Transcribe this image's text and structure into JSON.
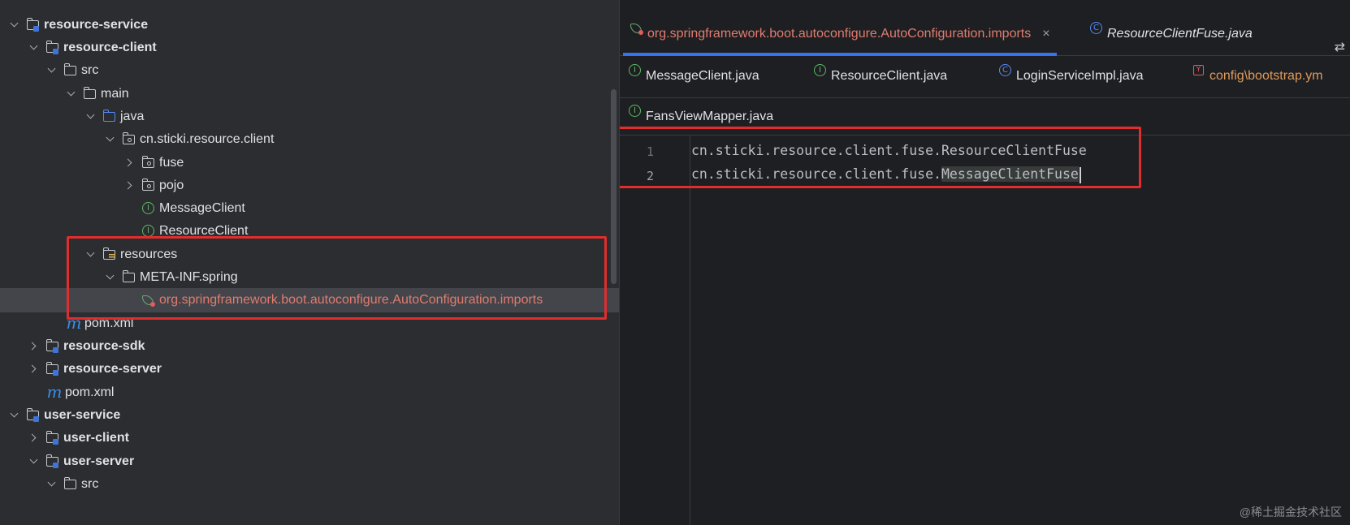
{
  "project_tree": {
    "rows": [
      {
        "label": "resource-service",
        "bold": true
      },
      {
        "label": "resource-client",
        "bold": true
      },
      {
        "label": "src"
      },
      {
        "label": "main"
      },
      {
        "label": "java"
      },
      {
        "label": "cn.sticki.resource.client"
      },
      {
        "label": "fuse"
      },
      {
        "label": "pojo"
      },
      {
        "label": "MessageClient"
      },
      {
        "label": "ResourceClient"
      },
      {
        "label": "resources"
      },
      {
        "label": "META-INF.spring"
      },
      {
        "label": "org.springframework.boot.autoconfigure.AutoConfiguration.imports"
      },
      {
        "label": "pom.xml"
      },
      {
        "label": "resource-sdk",
        "bold": true
      },
      {
        "label": "resource-server",
        "bold": true
      },
      {
        "label": "pom.xml"
      },
      {
        "label": "user-service",
        "bold": true
      },
      {
        "label": "user-client",
        "bold": true
      },
      {
        "label": "user-server",
        "bold": true
      },
      {
        "label": "src"
      }
    ]
  },
  "editor": {
    "tabs_row1": [
      {
        "label": "org.springframework.boot.autoconfigure.AutoConfiguration.imports",
        "active": true,
        "icon": "spring-icon"
      },
      {
        "label": "ResourceClientFuse.java",
        "icon": "class-icon"
      }
    ],
    "tabs_row2": [
      {
        "label": "MessageClient.java",
        "icon": "interface-icon"
      },
      {
        "label": "ResourceClient.java",
        "icon": "interface-icon"
      },
      {
        "label": "LoginServiceImpl.java",
        "icon": "class-icon"
      },
      {
        "label": "config\\bootstrap.ym",
        "icon": "yaml-icon"
      }
    ],
    "tabs_row3": [
      {
        "label": "FansViewMapper.java",
        "icon": "interface-icon"
      }
    ],
    "close_glyph": "×",
    "lines": [
      {
        "num": "1",
        "prefix": "cn.sticki.resource.client.fuse.",
        "name": "ResourceClientFuse"
      },
      {
        "num": "2",
        "prefix": "cn.sticki.resource.client.fuse.",
        "name": "MessageClientFuse"
      }
    ]
  },
  "watermark": "@稀土掘金技术社区",
  "colors": {
    "highlight_box": "#e02d2d",
    "accent_tab": "#3574f0"
  }
}
